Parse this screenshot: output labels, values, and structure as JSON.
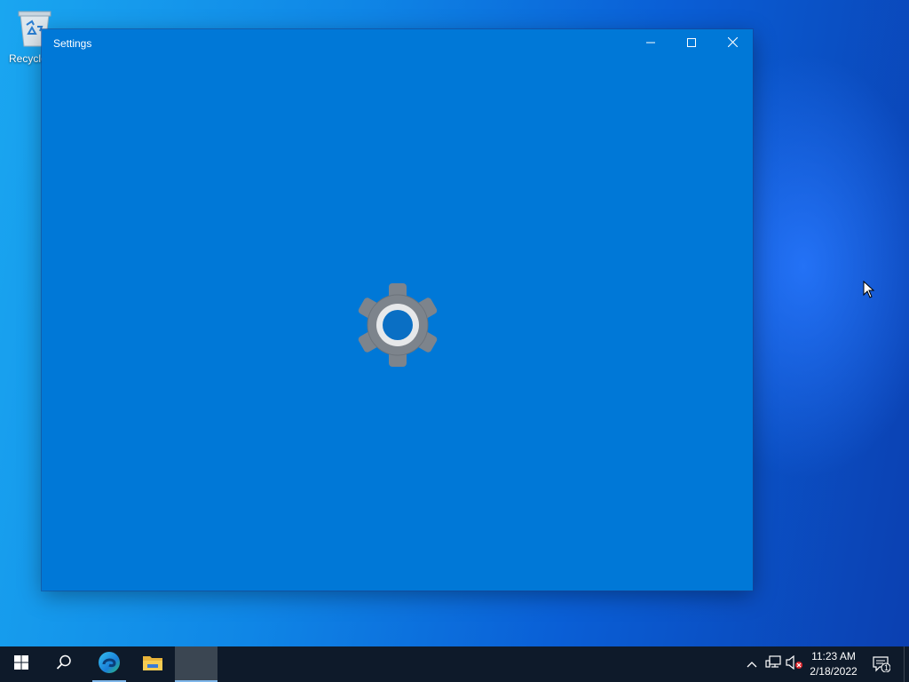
{
  "desktop": {
    "recycle_bin_label": "Recycle"
  },
  "window": {
    "title": "Settings",
    "minimize_icon": "minimize-icon",
    "maximize_icon": "maximize-icon",
    "close_icon": "close-icon",
    "splash_icon": "gear-icon"
  },
  "taskbar": {
    "apps": [
      {
        "name": "Start",
        "icon": "windows-logo-icon"
      },
      {
        "name": "Search",
        "icon": "search-icon"
      },
      {
        "name": "Microsoft Edge",
        "icon": "edge-icon"
      },
      {
        "name": "File Explorer",
        "icon": "folder-icon"
      },
      {
        "name": "Settings",
        "icon": "settings-icon"
      }
    ],
    "tray": {
      "chevron_icon": "chevron-up-icon",
      "network_icon": "network-icon",
      "volume_icon": "volume-muted-icon",
      "time": "11:23 AM",
      "date": "2/18/2022",
      "notification_count": "1"
    }
  },
  "colors": {
    "window_bg": "#0078d7",
    "taskbar_bg": "#0e1a2a",
    "accent_underline": "#7fb7ea"
  }
}
